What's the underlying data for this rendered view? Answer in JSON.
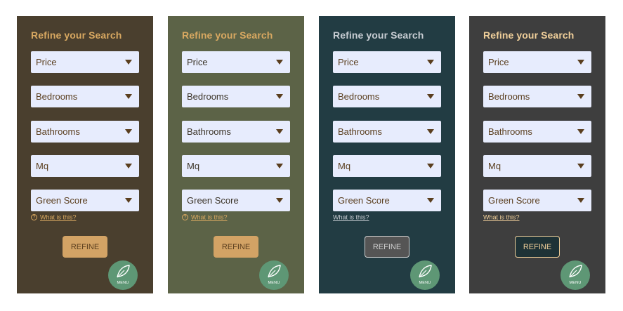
{
  "panels": [
    {
      "title": "Refine your Search",
      "filters": [
        "Price",
        "Bedrooms",
        "Bathrooms",
        "Mq",
        "Green Score"
      ],
      "help_text": "What is this?",
      "refine_label": "REFINE",
      "menu_label": "MENU",
      "colors": {
        "background": "#4a3f2e",
        "title": "#d8a861",
        "filter_text": "#5a3e1e",
        "caret": "#5a3e1e",
        "help_text": "#d8a861",
        "button_bg": "#d3a365",
        "button_text": "#5a3e1e",
        "button_border": "#d3a365"
      }
    },
    {
      "title": "Refine your Search",
      "filters": [
        "Price",
        "Bedrooms",
        "Bathrooms",
        "Mq",
        "Green Score"
      ],
      "help_text": "What is this?",
      "refine_label": "REFINE",
      "menu_label": "MENU",
      "colors": {
        "background": "#5c6347",
        "title": "#d8a861",
        "filter_text": "#3b3428",
        "caret": "#5a3e1e",
        "help_text": "#d8a861",
        "button_bg": "#d3a365",
        "button_text": "#5a3e1e",
        "button_border": "#d3a365"
      }
    },
    {
      "title": "Refine your Search",
      "filters": [
        "Price",
        "Bedrooms",
        "Bathrooms",
        "Mq",
        "Green Score"
      ],
      "help_text": "What is this?",
      "refine_label": "REFINE",
      "menu_label": "MENU",
      "colors": {
        "background": "#223c43",
        "title": "#c7ccd2",
        "filter_text": "#5a3e1e",
        "caret": "#5a3e1e",
        "help_text": "#c7ccd2",
        "button_bg": "#555555",
        "button_text": "#cfcfcf",
        "button_border": "#cfcfcf"
      }
    },
    {
      "title": "Refine your Search",
      "filters": [
        "Price",
        "Bedrooms",
        "Bathrooms",
        "Mq",
        "Green Score"
      ],
      "help_text": "What is this?",
      "refine_label": "REFINE",
      "menu_label": "MENU",
      "colors": {
        "background": "#3e3e3e",
        "title": "#f0cf9a",
        "filter_text": "#5a3e1e",
        "caret": "#5a3e1e",
        "help_text": "#f0cf9a",
        "button_bg": "#1e3236",
        "button_text": "#f0cf9a",
        "button_border": "#f0cf9a"
      }
    }
  ],
  "icons": {
    "help": "question-circle-icon",
    "menu": "leaf-icon",
    "dropdown": "caret-down-icon"
  }
}
